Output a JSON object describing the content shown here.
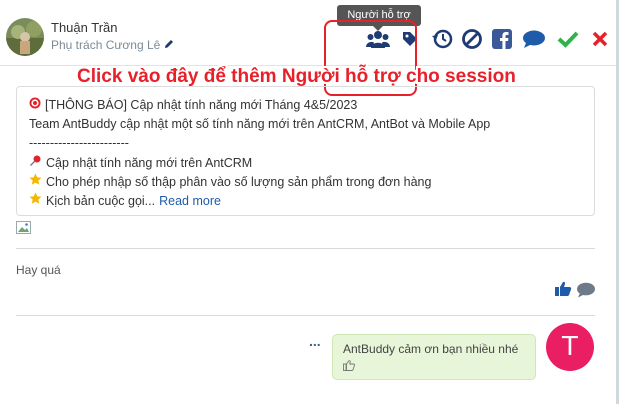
{
  "header": {
    "user_name": "Thuận Trần",
    "user_role": "Phụ trách Cương Lê",
    "tooltip": "Người hỗ trợ",
    "actions": [
      {
        "icon": "users-icon",
        "label": "Người hỗ trợ"
      },
      {
        "icon": "tag-icon"
      },
      {
        "icon": "history-icon"
      },
      {
        "icon": "block-icon"
      },
      {
        "icon": "facebook-icon"
      },
      {
        "icon": "chat-icon"
      },
      {
        "icon": "check-icon"
      },
      {
        "icon": "close-icon"
      }
    ]
  },
  "callout": "Click vào đây để thêm Người hỗ trợ cho session",
  "announcement": {
    "title": "[THÔNG BÁO] Cập nhật tính năng mới Tháng 4&5/2023",
    "intro": "Team AntBuddy cập nhật một số tính năng mới trên AntCRM, AntBot và Mobile App",
    "separator": "------------------------",
    "item1": "Cập nhật tính năng mới trên AntCRM",
    "item2": "Cho phép nhập số thập phân vào số lượng sản phẩm trong đơn hàng",
    "item3": "Kịch bản cuộc gọi...",
    "read_more": "Read more"
  },
  "comment": "Hay quá",
  "reply": {
    "dots": "...",
    "text": "AntBuddy cảm ơn bạn nhiều nhé",
    "avatar_letter": "T"
  },
  "colors": {
    "accent_red": "#e8202a",
    "link_blue": "#1f5ba8",
    "icon_navy": "#1f3b73",
    "facebook": "#3b5998",
    "check_green": "#2eb34a",
    "avatar_pink": "#e91e63",
    "bubble_green": "#e7f5d8"
  }
}
